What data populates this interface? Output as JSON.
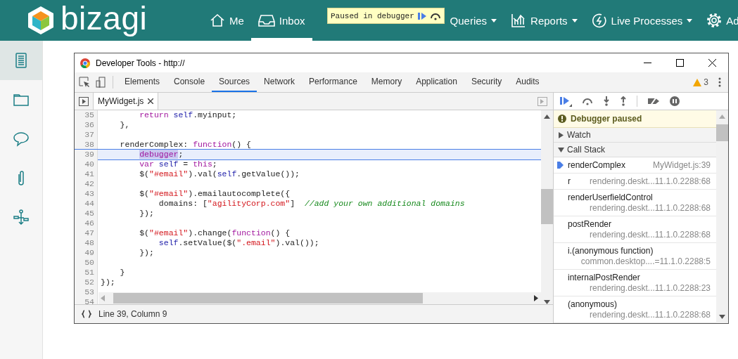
{
  "app": {
    "logo_text": "bizagi"
  },
  "nav": [
    {
      "label": "Me",
      "selected": false
    },
    {
      "label": "Inbox",
      "selected": true
    },
    {
      "label": "Queries",
      "selected": false,
      "caret": true
    },
    {
      "label": "Reports",
      "selected": false,
      "caret": true
    },
    {
      "label": "Live Processes",
      "selected": false,
      "caret": true
    },
    {
      "label": "Ad",
      "selected": false
    }
  ],
  "debugger_tooltip": {
    "text": "Paused in debugger"
  },
  "sidebar": {
    "items": [
      {
        "selected": true
      },
      {
        "selected": false
      },
      {
        "selected": false
      },
      {
        "selected": false
      },
      {
        "selected": false
      }
    ]
  },
  "devtools": {
    "window_title": "Developer Tools - http://",
    "tabs": [
      {
        "label": "Elements",
        "selected": false
      },
      {
        "label": "Console",
        "selected": false
      },
      {
        "label": "Sources",
        "selected": true
      },
      {
        "label": "Network",
        "selected": false
      },
      {
        "label": "Performance",
        "selected": false
      },
      {
        "label": "Memory",
        "selected": false
      },
      {
        "label": "Application",
        "selected": false
      },
      {
        "label": "Security",
        "selected": false
      },
      {
        "label": "Audits",
        "selected": false
      }
    ],
    "warnings": "3",
    "file_tab": "MyWidget.js",
    "code_lines": [
      {
        "number": "35",
        "selected": false,
        "tokens": [
          {
            "text": "        return",
            "kind": "keyword"
          },
          {
            "text": " self",
            "kind": "variable"
          },
          {
            "text": ".myinput;"
          }
        ]
      },
      {
        "number": "36",
        "selected": false,
        "tokens": [
          {
            "text": "    },"
          }
        ]
      },
      {
        "number": "37",
        "selected": false
      },
      {
        "number": "38",
        "selected": false,
        "tokens": [
          {
            "text": "    renderComplex: "
          },
          {
            "text": "function",
            "kind": "keyword"
          },
          {
            "text": "() {"
          }
        ]
      },
      {
        "number": "39",
        "selected": true,
        "tokens": [
          {
            "text": "        debugger",
            "kind": "keyword",
            "selected": true
          },
          {
            "text": ";"
          }
        ]
      },
      {
        "number": "40",
        "selected": false,
        "tokens": [
          {
            "text": "        var",
            "kind": "keyword"
          },
          {
            "text": " self",
            "kind": "variable"
          },
          {
            "text": " = "
          },
          {
            "text": "this",
            "kind": "keyword"
          },
          {
            "text": ";"
          }
        ]
      },
      {
        "number": "41",
        "selected": false,
        "tokens": [
          {
            "text": "        $("
          },
          {
            "text": "\"#email\"",
            "kind": "string"
          },
          {
            "text": ").val("
          },
          {
            "text": "self",
            "kind": "variable"
          },
          {
            "text": ".getValue());"
          }
        ]
      },
      {
        "number": "42",
        "selected": false
      },
      {
        "number": "43",
        "selected": false,
        "tokens": [
          {
            "text": "        $("
          },
          {
            "text": "\"#email\"",
            "kind": "string"
          },
          {
            "text": ").emailautocomplete({"
          }
        ]
      },
      {
        "number": "44",
        "selected": false,
        "tokens": [
          {
            "text": "            domains: ["
          },
          {
            "text": "\"agilityCorp.com\"",
            "kind": "string"
          },
          {
            "text": "]  "
          },
          {
            "text": "//add your own additional domains",
            "kind": "comment"
          }
        ]
      },
      {
        "number": "45",
        "selected": false,
        "tokens": [
          {
            "text": "        });"
          }
        ]
      },
      {
        "number": "46",
        "selected": false
      },
      {
        "number": "47",
        "selected": false,
        "tokens": [
          {
            "text": "        $("
          },
          {
            "text": "\"#email\"",
            "kind": "string"
          },
          {
            "text": ").change("
          },
          {
            "text": "function",
            "kind": "keyword"
          },
          {
            "text": "() {"
          }
        ]
      },
      {
        "number": "48",
        "selected": false,
        "tokens": [
          {
            "text": "            self",
            "kind": "variable"
          },
          {
            "text": ".setValue($("
          },
          {
            "text": "\".email\"",
            "kind": "string"
          },
          {
            "text": ").val());"
          }
        ]
      },
      {
        "number": "49",
        "selected": false,
        "tokens": [
          {
            "text": "        });"
          }
        ]
      },
      {
        "number": "50",
        "selected": false
      },
      {
        "number": "51",
        "selected": false,
        "tokens": [
          {
            "text": "    }"
          }
        ]
      },
      {
        "number": "52",
        "selected": false,
        "tokens": [
          {
            "text": "});"
          }
        ]
      },
      {
        "number": "53",
        "selected": false
      },
      {
        "number": "54",
        "selected": false
      }
    ],
    "status": "Line 39, Column 9",
    "paused_message": "Debugger paused",
    "sections": [
      {
        "label": "Watch",
        "expanded": false
      },
      {
        "label": "Call Stack",
        "expanded": true
      }
    ],
    "call_stack": [
      {
        "name": "renderComplex",
        "location": "MyWidget.js:39",
        "selected": true
      },
      {
        "name": "r",
        "location": "rendering.deskt...11.1.0.2288:68",
        "selected": false
      },
      {
        "name": "renderUserfieldControl",
        "location": "rendering.deskt...11.1.0.2288:68",
        "selected": false
      },
      {
        "name": "postRender",
        "location": "rendering.deskt...11.1.0.2288:68",
        "selected": false
      },
      {
        "name": "i.(anonymous function)",
        "location": "common.desktop....=11.1.0.2288:5",
        "selected": false
      },
      {
        "name": "internalPostRender",
        "location": "rendering.deskt...11.1.0.2288:23",
        "selected": false
      },
      {
        "name": "(anonymous)",
        "location": "rendering.deskt...11.1.0.2288:68",
        "selected": false
      }
    ]
  }
}
